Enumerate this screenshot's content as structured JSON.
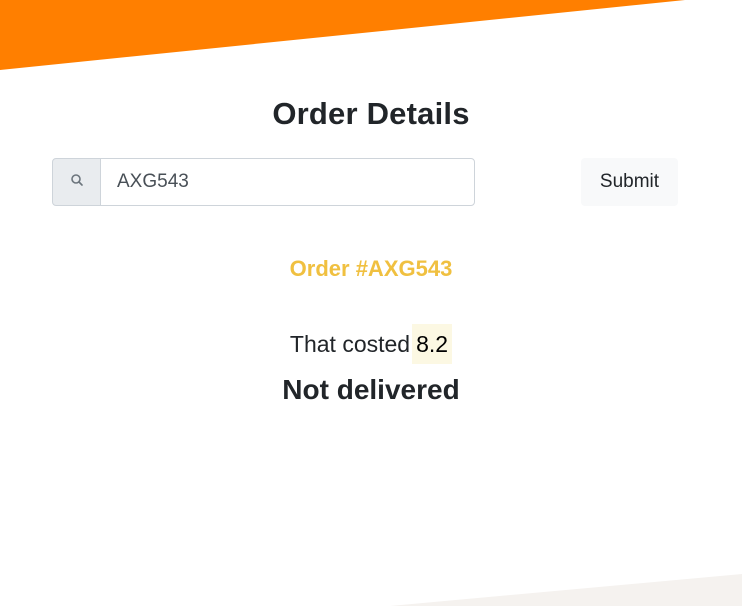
{
  "header": {
    "title": "Order Details"
  },
  "search": {
    "icon": "search-icon",
    "value": "AXG543",
    "placeholder": ""
  },
  "submit": {
    "label": "Submit"
  },
  "order": {
    "heading": "Order #AXG543",
    "cost_prefix": "That costed",
    "cost_value": "8.2",
    "status": "Not delivered"
  },
  "colors": {
    "accent_orange": "#ff7f00",
    "heading_yellow": "#f0c040",
    "price_highlight": "#fcf8e3",
    "bottom_wave": "#f5f2ef"
  }
}
